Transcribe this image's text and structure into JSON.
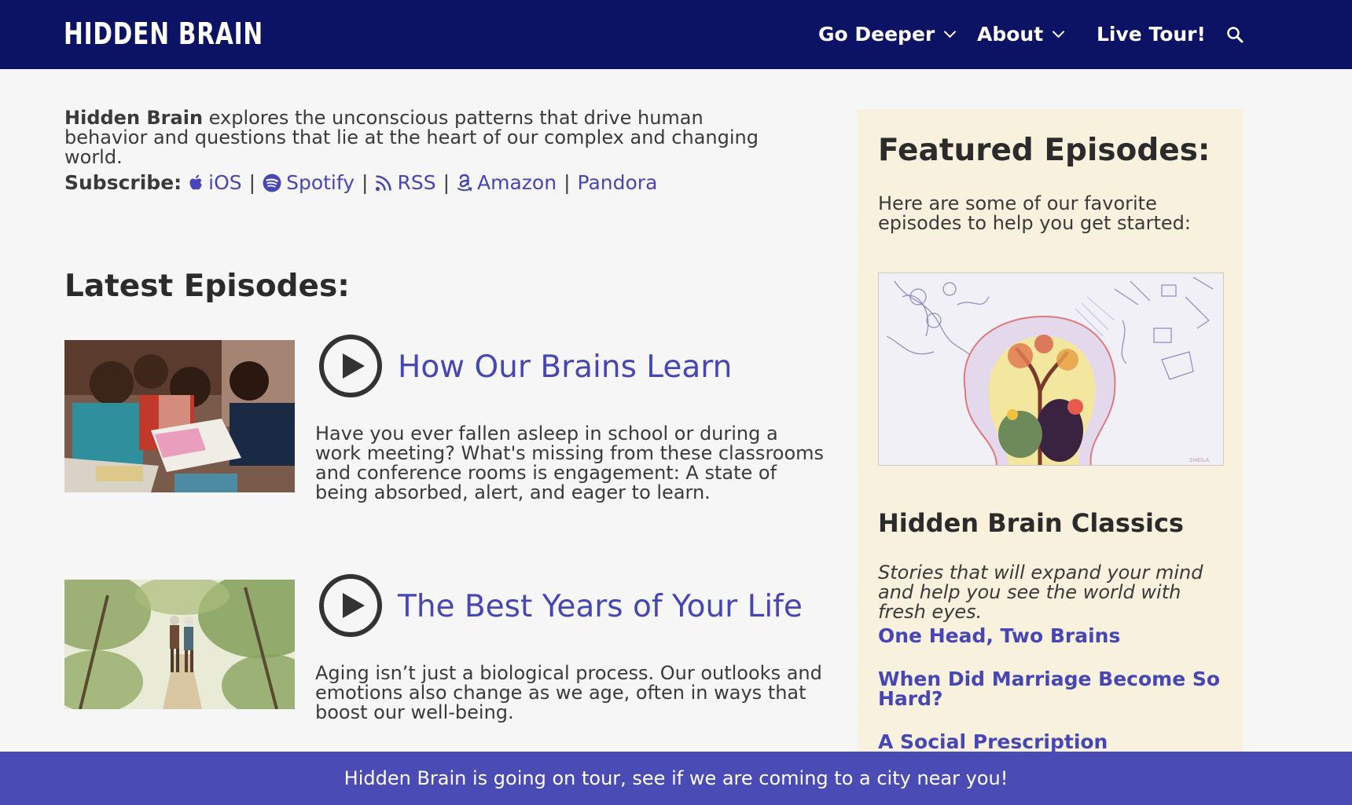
{
  "header": {
    "logo_text": "HIDDEN BRAIN",
    "nav": [
      {
        "label": "Go Deeper"
      },
      {
        "label": "About"
      },
      {
        "label": "Live Tour!"
      }
    ]
  },
  "intro": {
    "brand": "Hidden Brain",
    "text": " explores the unconscious patterns that drive human behavior and questions that lie at the heart of our complex and changing world."
  },
  "subscribe": {
    "label": "Subscribe:",
    "links": [
      {
        "label": "iOS",
        "icon": "apple-icon"
      },
      {
        "label": "Spotify",
        "icon": "spotify-icon"
      },
      {
        "label": "RSS",
        "icon": "rss-icon"
      },
      {
        "label": "Amazon",
        "icon": "amazon-icon"
      },
      {
        "label": "Pandora"
      }
    ],
    "separator": "|"
  },
  "latest": {
    "title": "Latest Episodes:",
    "episodes": [
      {
        "title": "How Our Brains Learn",
        "description": "Have you ever fallen asleep in school or during a work meeting? What's missing from these classrooms and conference rooms is engagement: A state of being absorbed, alert, and eager to learn."
      },
      {
        "title": "The Best Years of Your Life",
        "description": "Aging isn’t just a biological process. Our outlooks and emotions also change as we age, often in ways that boost our well-being."
      }
    ]
  },
  "sidebar": {
    "featured_title": "Featured Episodes:",
    "featured_desc": "Here are some of our favorite episodes to help you get started:",
    "classics_title": "Hidden Brain Classics",
    "classics_sub": "Stories that will expand your mind and help you see the world with fresh eyes.",
    "classics": [
      {
        "label": "One Head, Two Brains"
      },
      {
        "label": "When Did Marriage Become So Hard?"
      },
      {
        "label": "A Social Prescription"
      }
    ]
  },
  "banner": {
    "text": "Hidden Brain is going on tour, see if we are coming to a city near you!"
  },
  "colors": {
    "header_bg": "#0c1264",
    "link": "#4646b7",
    "sidebar_bg": "#f7f1de",
    "banner_bg": "#4a4bb4"
  }
}
